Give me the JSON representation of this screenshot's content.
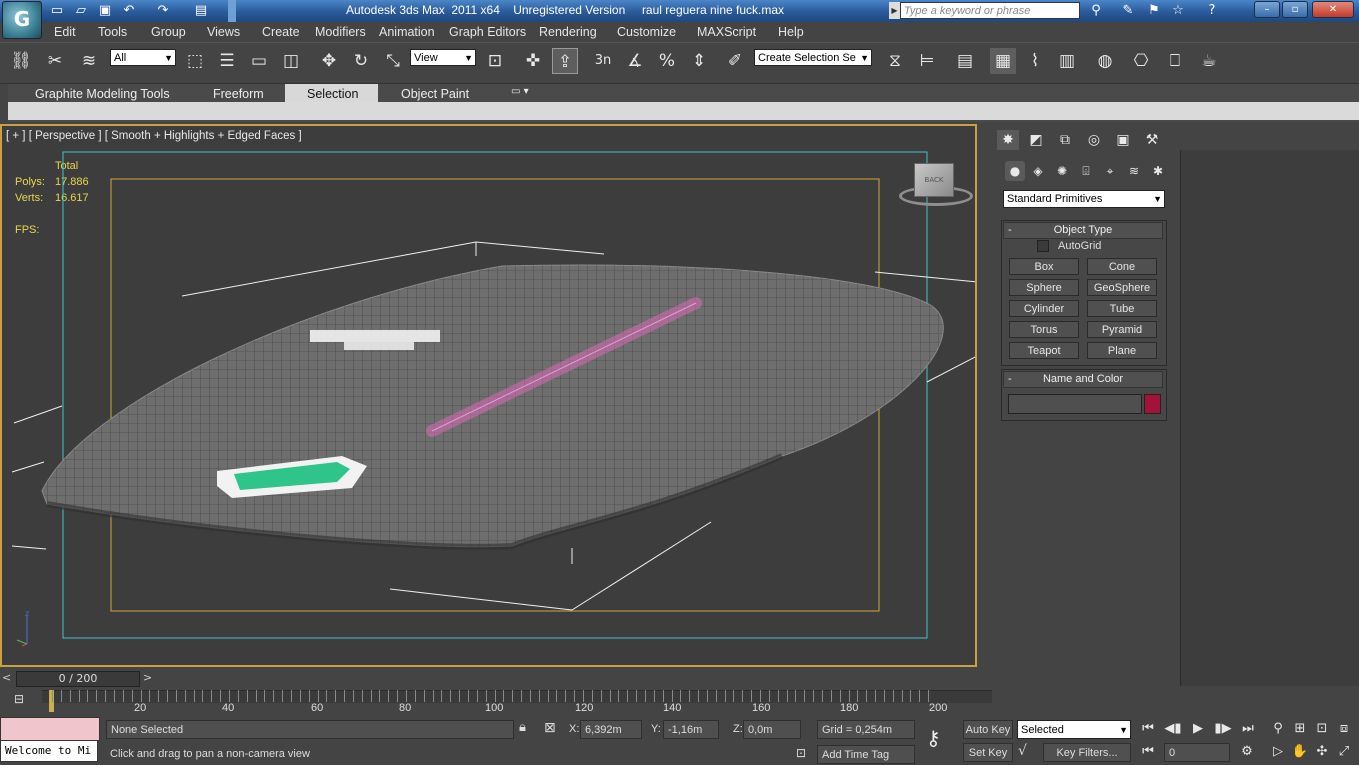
{
  "titlebar": {
    "title": "Autodesk 3ds Max  2011 x64    Unregistered Version     raul reguera nine fuck.max",
    "search_placeholder": "Type a keyword or phrase"
  },
  "menu": [
    "Edit",
    "Tools",
    "Group",
    "Views",
    "Create",
    "Modifiers",
    "Animation",
    "Graph Editors",
    "Rendering",
    "Customize",
    "MAXScript",
    "Help"
  ],
  "toolbar": {
    "selection_filter": "All",
    "reference_coord": "View",
    "named_selection": "Create Selection Se",
    "snap_label": "3n"
  },
  "ribbon": {
    "tabs": [
      "Graphite Modeling Tools",
      "Freeform",
      "Selection",
      "Object Paint"
    ],
    "active_tab": "Selection"
  },
  "viewport": {
    "label": "[ + ] [ Perspective ] [ Smooth + Highlights + Edged Faces ]",
    "stats": {
      "total_label": "Total",
      "polys_label": "Polys:",
      "polys_value": "17.886",
      "verts_label": "Verts:",
      "verts_value": "16.617",
      "fps_label": "FPS:"
    },
    "viewcube_label": "BACK"
  },
  "command_panel": {
    "category": "Standard Primitives",
    "object_type_header": "Object Type",
    "autogrid_label": "AutoGrid",
    "buttons": [
      "Box",
      "Cone",
      "Sphere",
      "GeoSphere",
      "Cylinder",
      "Tube",
      "Torus",
      "Pyramid",
      "Teapot",
      "Plane"
    ],
    "name_color_header": "Name and Color",
    "object_color": "#a3123a"
  },
  "timeline": {
    "frame_display": "0 / 200",
    "ticks": [
      "20",
      "40",
      "60",
      "80",
      "100",
      "120",
      "140",
      "160",
      "180",
      "200"
    ]
  },
  "status": {
    "maxscript_text": "Welcome to Mi",
    "selection_text": "None Selected",
    "prompt_text": "Click and drag to pan a non-camera view",
    "x_label": "X:",
    "x_value": "6,392m",
    "y_label": "Y:",
    "y_value": "-1,16m",
    "z_label": "Z:",
    "z_value": "0,0m",
    "grid_text": "Grid = 0,254m",
    "add_time_tag": "Add Time Tag",
    "auto_key": "Auto Key",
    "set_key": "Set Key",
    "key_mode": "Selected",
    "key_filters": "Key Filters...",
    "current_frame": "0"
  }
}
